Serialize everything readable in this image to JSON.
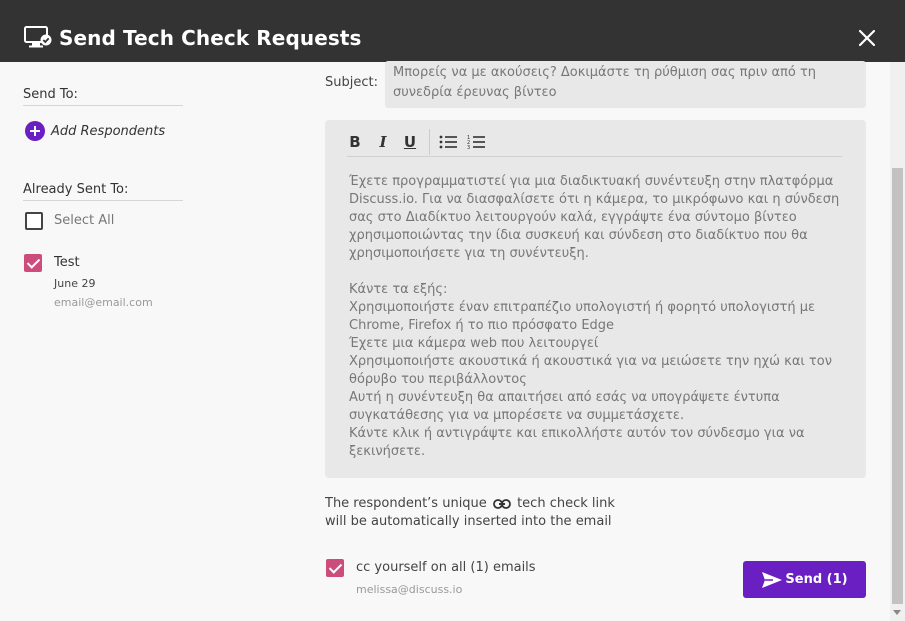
{
  "header": {
    "title": "Send Tech Check Requests",
    "title_icon": "monitor-check-icon",
    "close_icon": "close-icon"
  },
  "sidebar": {
    "send_to_label": "Send To:",
    "add_respondents_label": "Add Respondents",
    "already_sent_label": "Already Sent To:",
    "select_all_label": "Select All",
    "select_all_checked": false,
    "recipients": [
      {
        "name": "Test",
        "date": "June 29",
        "email": "email@email.com",
        "checked": true
      }
    ]
  },
  "form": {
    "subject_label": "Subject:",
    "subject_value": "Μπορείς να με ακούσεις? Δοκιμάστε τη ρύθμιση σας πριν από τη συνεδρία έρευνας βίντεο",
    "toolbar": {
      "bold": "B",
      "italic": "I",
      "underline": "U",
      "bullet_list_icon": "bullet-list-icon",
      "numbered_list_icon": "numbered-list-icon"
    },
    "body_text": "Έχετε προγραμματιστεί για μια διαδικτυακή συνέντευξη στην πλατφόρμα\nDiscuss.io. Για να διασφαλίσετε ότι η κάμερα, το μικρόφωνο και η σύνδεση\nσας στο Διαδίκτυο λειτουργούν καλά, εγγράψτε ένα σύντομο βίντεο\nχρησιμοποιώντας την ίδια συσκευή και σύνδεση στο διαδίκτυο που θα\nχρησιμοποιήσετε για τη συνέντευξη.\n\nΚάντε τα εξής:\nΧρησιμοποιήστε έναν επιτραπέζιο υπολογιστή ή φορητό υπολογιστή με\nChrome, Firefox ή το πιο πρόσφατο Edge\nΈχετε μια κάμερα web που λειτουργεί\nΧρησιμοποιήστε ακουστικά ή ακουστικά για να μειώσετε την ηχώ και τον\nθόρυβο του περιβάλλοντος\nΑυτή η συνέντευξη θα απαιτήσει από εσάς να υπογράψετε έντυπα\nσυγκατάθεσης για να μπορέσετε να συμμετάσχετε.\nΚάντε κλικ ή αντιγράψτε και επικολλήστε αυτόν τον σύνδεσμο για να\nξεκινήσετε.",
    "info_line1_before": "The respondent’s unique",
    "info_line1_after": "tech check link",
    "info_line2": "will be automatically inserted into the email",
    "link_icon": "link-icon",
    "cc_label": "cc yourself on all (1) emails",
    "cc_checked": true,
    "cc_email": "melissa@discuss.io",
    "send_label": "Send (1)"
  },
  "colors": {
    "header_bg": "#333333",
    "accent_purple": "#6a1fc3",
    "checkbox_pink": "#cc4d7c"
  }
}
